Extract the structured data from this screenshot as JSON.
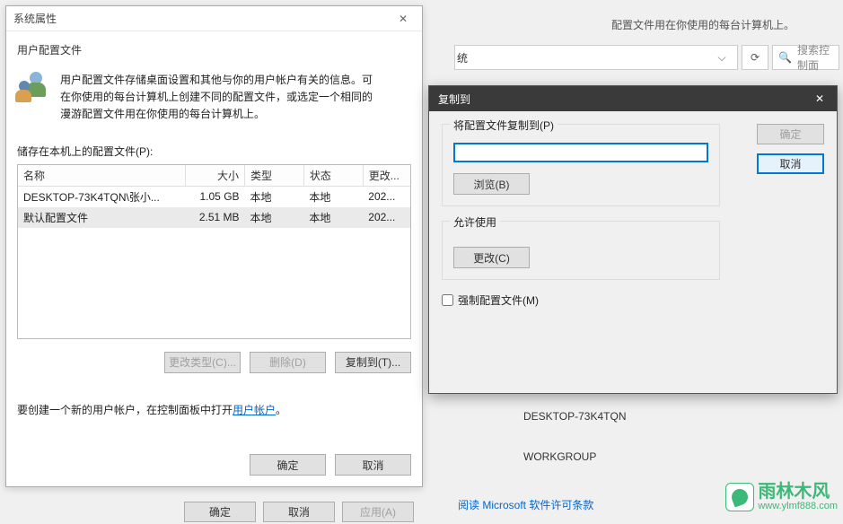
{
  "bg": {
    "top_text": "配置文件用在你使用的每台计算机上。",
    "dropdown_suffix": "统",
    "search_placeholder": "搜索控制面",
    "info1": "DESKTOP-73K4TQN",
    "info2": "WORKGROUP",
    "link": "阅读 Microsoft 软件许可条款",
    "btn_ok": "确定",
    "btn_cancel": "取消",
    "btn_apply": "应用(A)"
  },
  "watermark": {
    "title": "雨林木风",
    "url": "www.ylmf888.com"
  },
  "win1": {
    "title": "系统属性"
  },
  "win2": {
    "subtitle": "用户配置文件",
    "desc": "用户配置文件存储桌面设置和其他与你的用户帐户有关的信息。可在你使用的每台计算机上创建不同的配置文件，或选定一个相同的漫游配置文件用在你使用的每台计算机上。",
    "stored_label": "储存在本机上的配置文件(P):",
    "headers": {
      "name": "名称",
      "size": "大小",
      "type": "类型",
      "status": "状态",
      "mod": "更改..."
    },
    "rows": [
      {
        "name": "DESKTOP-73K4TQN\\张小...",
        "size": "1.05 GB",
        "type": "本地",
        "status": "本地",
        "mod": "202..."
      },
      {
        "name": "默认配置文件",
        "size": "2.51 MB",
        "type": "本地",
        "status": "本地",
        "mod": "202..."
      }
    ],
    "btn_change_type": "更改类型(C)...",
    "btn_delete": "删除(D)",
    "btn_copy": "复制到(T)...",
    "create_prefix": "要创建一个新的用户帐户，在控制面板中打开",
    "create_link": "用户帐户",
    "create_suffix": "。",
    "btn_ok": "确定",
    "btn_cancel": "取消"
  },
  "win3": {
    "title": "复制到",
    "group1_label": "将配置文件复制到(P)",
    "input_value": "",
    "btn_browse": "浏览(B)",
    "group2_label": "允许使用",
    "btn_change": "更改(C)",
    "cb_label": "强制配置文件(M)",
    "btn_ok": "确定",
    "btn_cancel": "取消"
  }
}
